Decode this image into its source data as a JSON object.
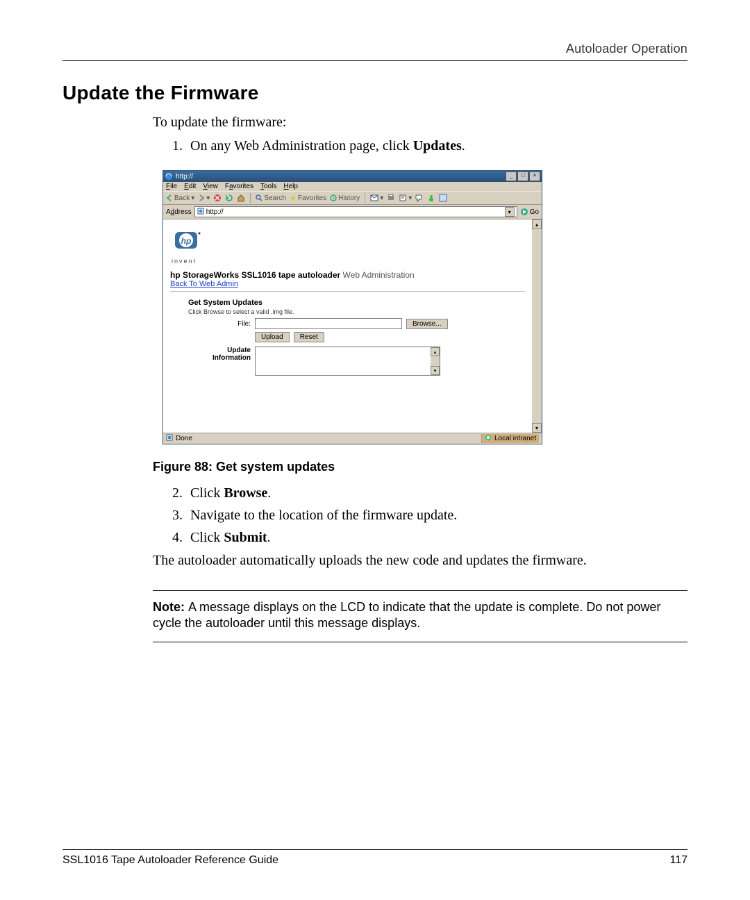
{
  "header": {
    "section": "Autoloader Operation"
  },
  "heading": "Update the Firmware",
  "intro": "To update the firmware:",
  "steps1": {
    "s1_a": "On any Web Administration page, click ",
    "s1_b": "Updates",
    "s1_c": "."
  },
  "figure": {
    "number": "Figure 88:  ",
    "title": "Get system updates"
  },
  "steps2": {
    "s2_a": "Click ",
    "s2_b": "Browse",
    "s2_c": ".",
    "s3": "Navigate to the location of the firmware update.",
    "s4_a": "Click ",
    "s4_b": "Submit",
    "s4_c": "."
  },
  "para2": "The autoloader automatically uploads the new code and updates the firmware.",
  "note_label": "Note:  ",
  "note_body": "A message displays on the LCD to indicate that the update is complete. Do not power cycle the autoloader until this message displays.",
  "footer": {
    "left": "SSL1016 Tape Autoloader Reference Guide",
    "right": "117"
  },
  "screenshot": {
    "title": "http://",
    "menus": {
      "file": "File",
      "edit": "Edit",
      "view": "View",
      "favorites": "Favorites",
      "tools": "Tools",
      "help": "Help"
    },
    "toolbar": {
      "back": "Back",
      "search": "Search",
      "favorites": "Favorites",
      "history": "History"
    },
    "address_label": "Address",
    "address_value": "http://",
    "go": "Go",
    "invent": "invent",
    "product_title": "hp StorageWorks SSL1016 tape autoloader",
    "product_web": "Web Administration",
    "back_link": "Back To Web Admin",
    "form": {
      "heading": "Get System Updates",
      "sub": "Click Browse to select a valid .img file.",
      "file_label": "File:",
      "browse": "Browse...",
      "upload": "Upload",
      "reset": "Reset",
      "info": "Update Information"
    },
    "status_left": "Done",
    "status_right": "Local intranet"
  }
}
